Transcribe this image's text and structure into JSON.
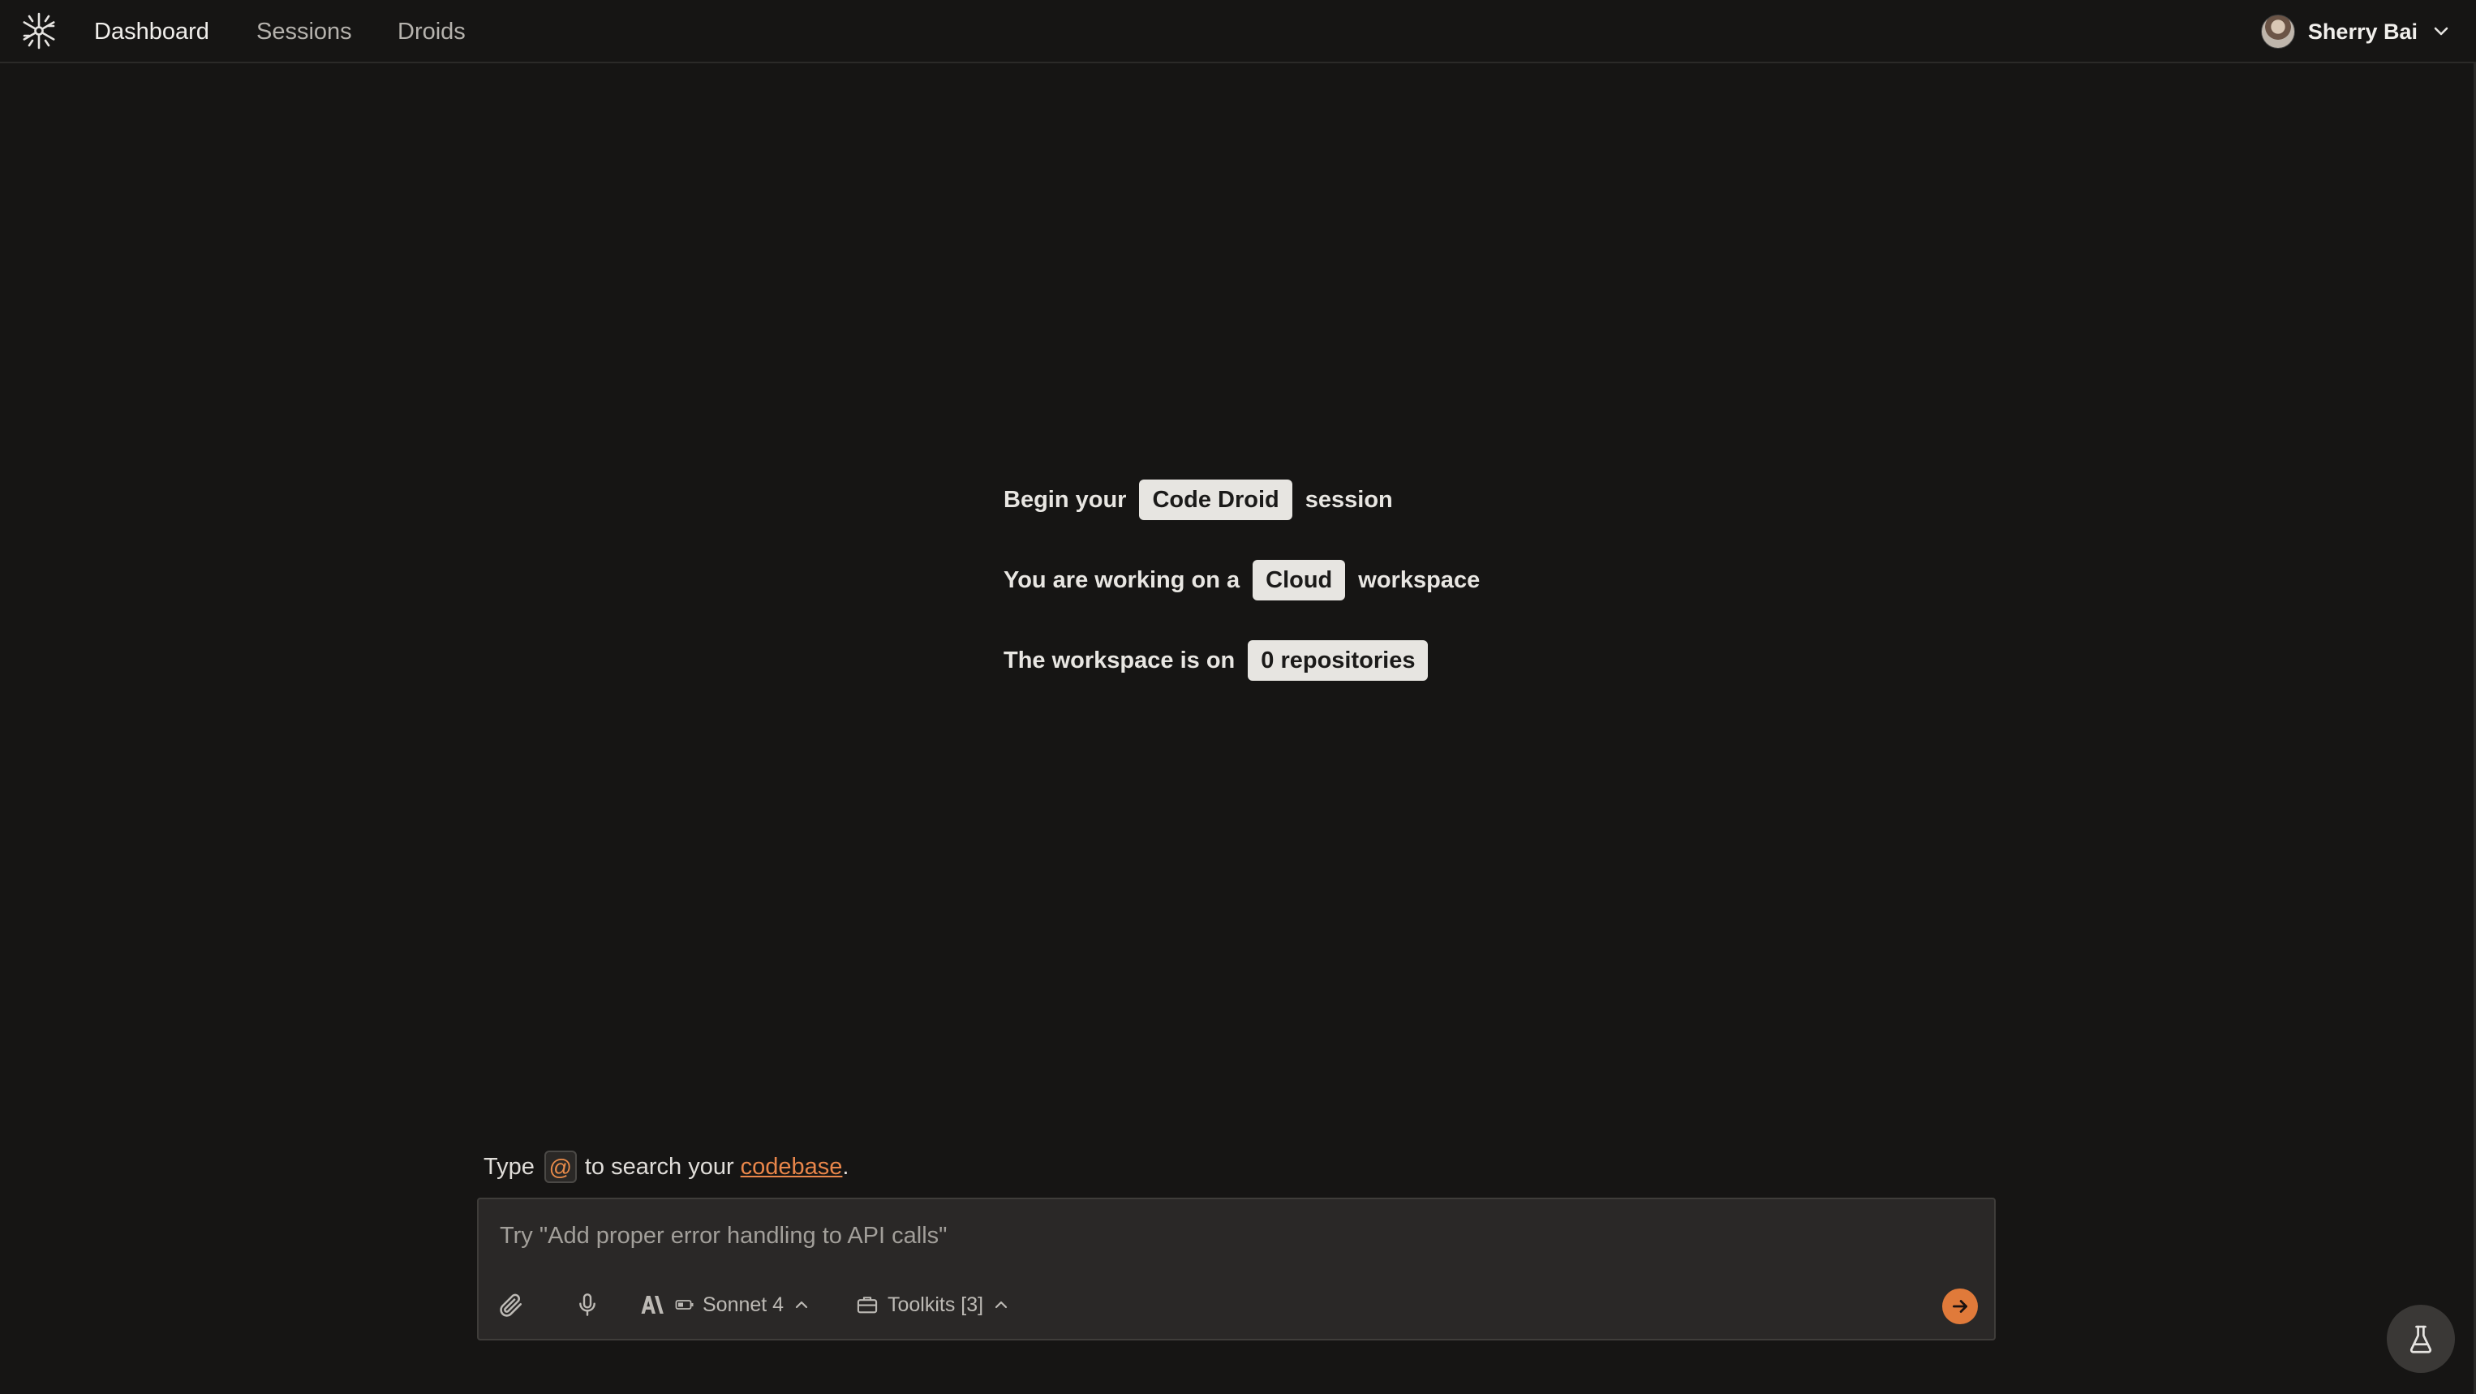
{
  "nav": {
    "logo_icon": "asterisk-logo-icon",
    "items": [
      {
        "label": "Dashboard",
        "active": true
      },
      {
        "label": "Sessions",
        "active": false
      },
      {
        "label": "Droids",
        "active": false
      }
    ],
    "user": {
      "name": "Sherry Bai",
      "menu_icon": "chevron-down-icon"
    }
  },
  "intro": {
    "line1": {
      "before": "Begin your",
      "pill": "Code Droid",
      "after": "session"
    },
    "line2": {
      "before": "You are working on a",
      "pill": "Cloud",
      "after": "workspace"
    },
    "line3": {
      "before": "The workspace is on",
      "pill": "0 repositories"
    }
  },
  "hint": {
    "prefix": "Type",
    "key": "@",
    "middle": "to search your",
    "link": "codebase",
    "suffix": "."
  },
  "composer": {
    "placeholder": "Try \"Add proper error handling to API calls\"",
    "attach_icon": "paperclip-icon",
    "mic_icon": "microphone-icon",
    "model": {
      "label": "Sonnet 4",
      "icon": "anthropic-icon"
    },
    "toolkits": {
      "label": "Toolkits [3]",
      "icon": "briefcase-icon"
    },
    "send_icon": "arrow-right-icon"
  },
  "colors": {
    "background": "#161514",
    "accent": "#e07a3a",
    "pill_bg": "#e7e5e1",
    "composer_bg": "#2a2827"
  }
}
